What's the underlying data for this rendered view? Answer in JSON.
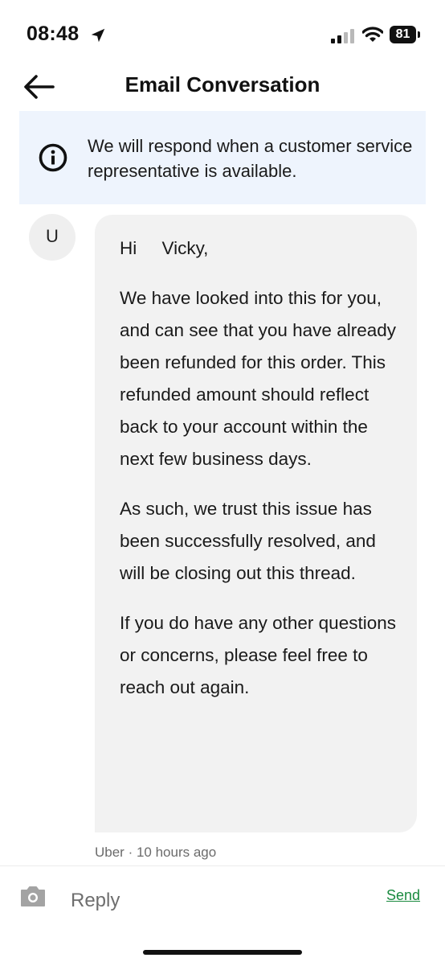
{
  "status_bar": {
    "time": "08:48",
    "battery": "81",
    "icons": [
      "location-arrow-icon",
      "cellular-signal-icon",
      "wifi-icon",
      "battery-icon"
    ]
  },
  "header": {
    "title": "Email Conversation",
    "back_icon": "back-arrow-icon"
  },
  "banner": {
    "icon": "info-icon",
    "text": "We will respond when a customer service representative is available."
  },
  "message": {
    "avatar_letter": "U",
    "greeting": "Hi     Vicky,",
    "paragraphs": [
      "We have looked into this for you, and can see that you have already been refunded for this order. This refunded amount should reflect back to your account within the next few business days.",
      "As such, we trust this issue has been successfully resolved, and will be closing out this thread.",
      "If you do have any other questions or concerns, please feel free to reach out again."
    ],
    "meta": "Uber · 10 hours ago"
  },
  "compose": {
    "camera_icon": "camera-icon",
    "placeholder": "Reply",
    "value": "",
    "send_label": "Send"
  },
  "colors": {
    "banner_bg": "#eef4fd",
    "bubble_bg": "#f2f2f2",
    "send_green": "#1a8a3f"
  }
}
